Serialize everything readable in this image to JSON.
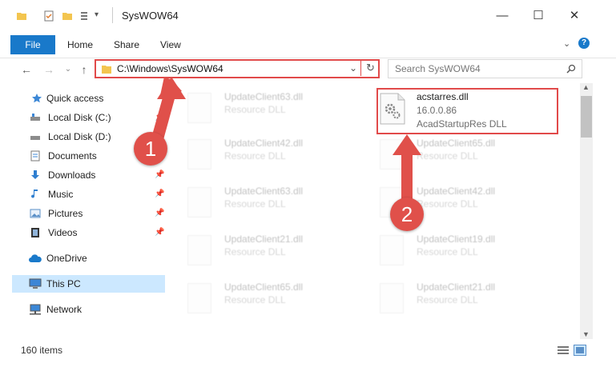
{
  "window": {
    "title": "SysWOW64",
    "controls": {
      "minimize": "—",
      "maximize": "☐",
      "close": "✕"
    }
  },
  "ribbon": {
    "tabs": [
      "File",
      "Home",
      "Share",
      "View"
    ]
  },
  "address_bar": {
    "path": "C:\\Windows\\SysWOW64"
  },
  "search": {
    "placeholder": "Search SysWOW64"
  },
  "sidebar": {
    "items": [
      {
        "label": "Quick access"
      },
      {
        "label": "Local Disk (C:)"
      },
      {
        "label": "Local Disk (D:)"
      },
      {
        "label": "Documents"
      },
      {
        "label": "Downloads"
      },
      {
        "label": "Music"
      },
      {
        "label": "Pictures"
      },
      {
        "label": "Videos"
      },
      {
        "label": "OneDrive"
      },
      {
        "label": "This PC"
      },
      {
        "label": "Network"
      }
    ]
  },
  "files": {
    "highlighted": {
      "name": "acstarres.dll",
      "version": "16.0.0.86",
      "description": "AcadStartupRes DLL"
    },
    "background": [
      {
        "name": "UpdateClient63.dll",
        "type": "Resource DLL"
      },
      {
        "name": "UpdateClient42.dll",
        "type": "Resource DLL"
      },
      {
        "name": "UpdateClient65.dll",
        "type": "Resource DLL"
      },
      {
        "name": "UpdateClient63.dll",
        "type": "Resource DLL"
      },
      {
        "name": "UpdateClient42.dll",
        "type": "Resource DLL"
      },
      {
        "name": "UpdateClient21.dll",
        "type": "Resource DLL"
      },
      {
        "name": "UpdateClient19.dll",
        "type": "Resource DLL"
      },
      {
        "name": "UpdateClient65.dll",
        "type": "Resource DLL"
      },
      {
        "name": "UpdateClient21.dll",
        "type": "Resource DLL"
      }
    ]
  },
  "status": {
    "items_count": "160 items"
  },
  "annotations": {
    "step1": "1",
    "step2": "2"
  },
  "colors": {
    "accent": "#1979ca",
    "highlight": "#e14a4a",
    "selection": "#cce8ff"
  }
}
